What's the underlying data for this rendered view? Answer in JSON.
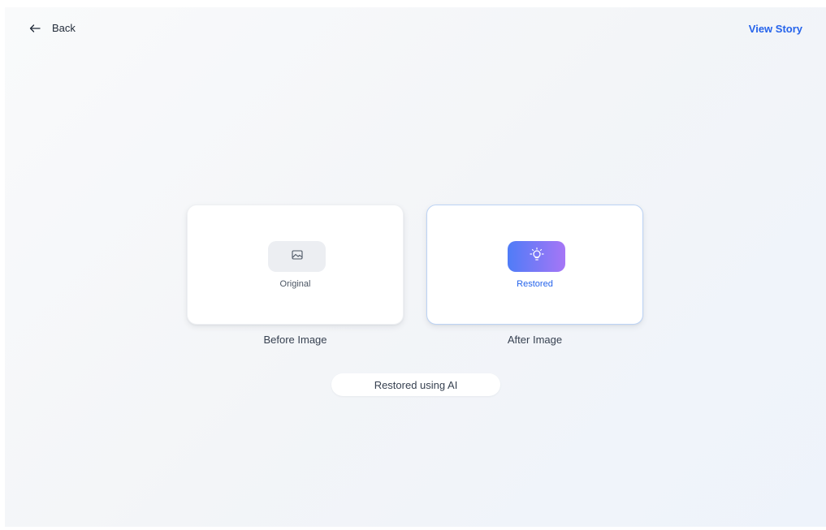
{
  "header": {
    "back_label": "Back",
    "view_story_label": "View Story"
  },
  "before": {
    "chip_label": "Original",
    "caption": "Before Image",
    "icon": "image-icon"
  },
  "after": {
    "chip_label": "Restored",
    "caption": "After Image",
    "icon": "lightbulb-icon"
  },
  "badge": {
    "label": "Restored using AI"
  },
  "colors": {
    "accent": "#2563eb",
    "gradient_start": "#4f7cf7",
    "gradient_end": "#a676f6",
    "after_border": "#bcd3f5"
  }
}
